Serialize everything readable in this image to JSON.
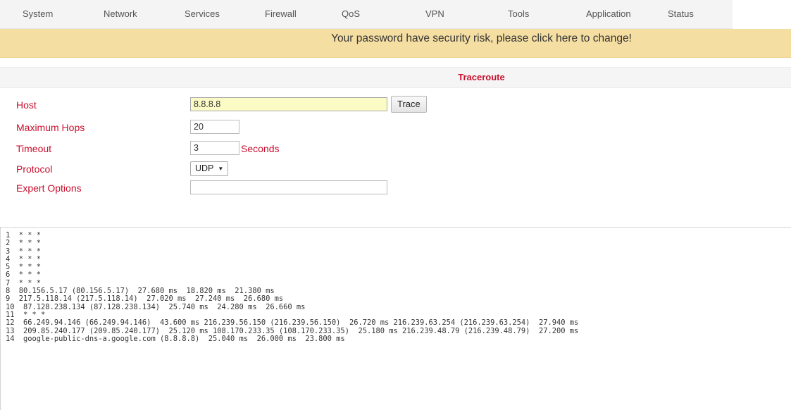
{
  "menu": {
    "items": [
      {
        "label": "System"
      },
      {
        "label": "Network"
      },
      {
        "label": "Services"
      },
      {
        "label": "Firewall"
      },
      {
        "label": "QoS"
      },
      {
        "label": "VPN"
      },
      {
        "label": "Tools"
      },
      {
        "label": "Application"
      },
      {
        "label": "Status"
      }
    ]
  },
  "alert": {
    "text": "Your password have security risk, please click here to change!"
  },
  "page": {
    "title": "Traceroute"
  },
  "form": {
    "host_label": "Host",
    "host_value": "8.8.8.8",
    "trace_button": "Trace",
    "max_hops_label": "Maximum Hops",
    "max_hops_value": "20",
    "timeout_label": "Timeout",
    "timeout_value": "3",
    "timeout_unit": "Seconds",
    "protocol_label": "Protocol",
    "protocol_value": "UDP",
    "expert_label": "Expert Options",
    "expert_value": ""
  },
  "output": {
    "lines": [
      "1  * * *",
      "2  * * *",
      "3  * * *",
      "4  * * *",
      "5  * * *",
      "6  * * *",
      "7  * * *",
      "8  80.156.5.17 (80.156.5.17)  27.680 ms  18.820 ms  21.380 ms",
      "9  217.5.118.14 (217.5.118.14)  27.020 ms  27.240 ms  26.680 ms",
      "10  87.128.238.134 (87.128.238.134)  25.740 ms  24.280 ms  26.660 ms",
      "11  * * *",
      "12  66.249.94.146 (66.249.94.146)  43.600 ms 216.239.56.150 (216.239.56.150)  26.720 ms 216.239.63.254 (216.239.63.254)  27.940 ms",
      "13  209.85.240.177 (209.85.240.177)  25.120 ms 108.170.233.35 (108.170.233.35)  25.180 ms 216.239.48.79 (216.239.48.79)  27.200 ms",
      "14  google-public-dns-a.google.com (8.8.8.8)  25.040 ms  26.000 ms  23.800 ms"
    ]
  },
  "colors": {
    "label_red": "#c8102e",
    "alert_bg": "#f5dea2",
    "host_input_bg": "#fbfbc6"
  }
}
